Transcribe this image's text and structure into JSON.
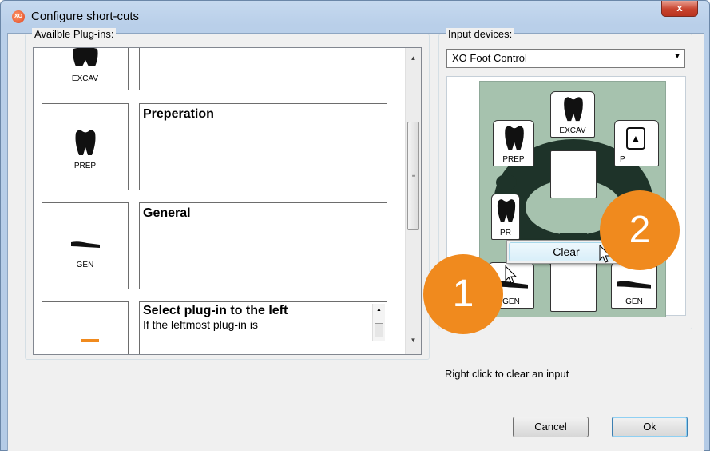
{
  "window": {
    "title": "Configure short-cuts",
    "close_glyph": "x",
    "app_icon_text": "XO"
  },
  "plugins_group": {
    "label": "Availble Plug-ins:",
    "items": [
      {
        "icon": "tooth-icon",
        "icon_label": "EXCAV",
        "title": "",
        "desc": ""
      },
      {
        "icon": "tooth-icon",
        "icon_label": "PREP",
        "title": "Preperation",
        "desc": ""
      },
      {
        "icon": "gen-tool-icon",
        "icon_label": "GEN",
        "title": "General",
        "desc": ""
      },
      {
        "icon": "orange-plugin-icon",
        "icon_label": "",
        "title": "Select plug-in to the left",
        "desc": "If the leftmost plug-in is"
      }
    ]
  },
  "devices_group": {
    "label": "Input devices:",
    "selected_device": "XO Foot Control",
    "pedal_slots": {
      "excav": "EXCAV",
      "prep": "PREP",
      "prep_partial": "PR",
      "gen_left": "GEN",
      "gen_right": "GEN",
      "right_partial": "P"
    }
  },
  "context_menu": {
    "clear_label": "Clear"
  },
  "badges": {
    "first": "1",
    "second": "2"
  },
  "hint": "Right click to clear an input",
  "buttons": {
    "cancel": "Cancel",
    "ok": "Ok"
  },
  "colors": {
    "badge": "#f08a1e",
    "pedal_green": "#a6c2ae",
    "pedal_dark": "#1e3329"
  }
}
